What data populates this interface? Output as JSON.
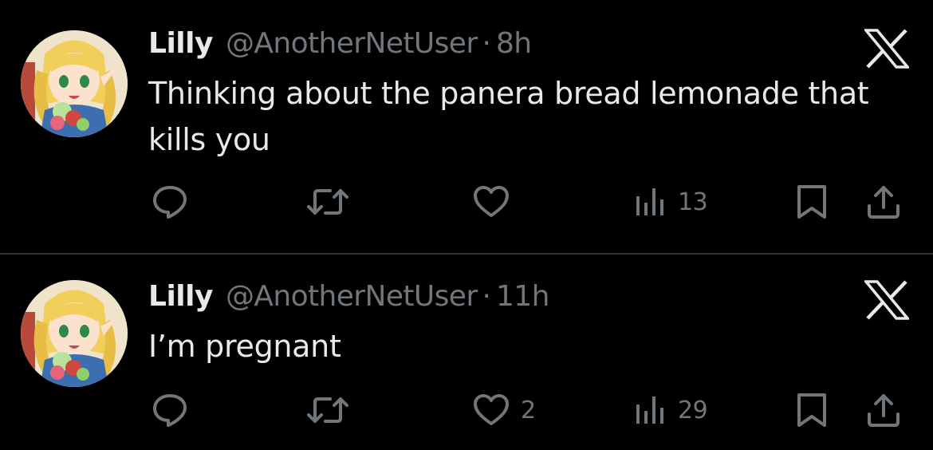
{
  "tweets": [
    {
      "name": "Lilly",
      "handle": "@AnotherNetUser",
      "separator": "·",
      "time": "8h",
      "text": "Thinking about the panera bread lemonade that kills you",
      "replies": "",
      "retweets": "",
      "likes": "",
      "views": "13"
    },
    {
      "name": "Lilly",
      "handle": "@AnotherNetUser",
      "separator": "·",
      "time": "11h",
      "text": "I’m pregnant",
      "replies": "",
      "retweets": "",
      "likes": "2",
      "views": "29"
    }
  ],
  "icons": {
    "brand": "x-logo-icon",
    "reply": "reply-icon",
    "retweet": "retweet-icon",
    "like": "heart-icon",
    "views": "views-icon",
    "bookmark": "bookmark-icon",
    "share": "share-icon"
  },
  "colors": {
    "background": "#000000",
    "text": "#e7e9ea",
    "secondary": "#71767b",
    "divider": "#2f3336"
  }
}
